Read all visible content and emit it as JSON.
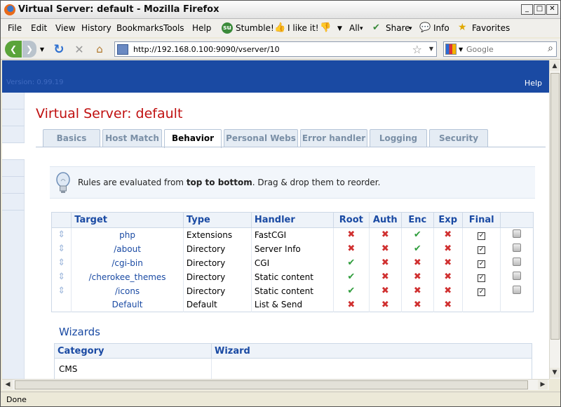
{
  "window": {
    "title": "Virtual Server: default - Mozilla Firefox"
  },
  "menu": [
    "File",
    "Edit",
    "View",
    "History",
    "Bookmarks",
    "Tools",
    "Help"
  ],
  "toolbar": {
    "stumble": "Stumble!",
    "like": "I like it!",
    "all": "All",
    "share": "Share",
    "info": "Info",
    "favorites": "Favorites"
  },
  "nav": {
    "url": "http://192.168.0.100:9090/vserver/10",
    "search_placeholder": "Google"
  },
  "app": {
    "version": "Version: 0.99.19",
    "help": "Help",
    "page_title": "Virtual Server: default",
    "tabs": [
      "Basics",
      "Host Match",
      "Behavior",
      "Personal Webs",
      "Error handler",
      "Logging",
      "Security"
    ],
    "active_tab": "Behavior",
    "notice_pre": "Rules are evaluated from ",
    "notice_bold": "top to bottom",
    "notice_post": ". Drag & drop them to reorder."
  },
  "rules": {
    "columns": [
      "Target",
      "Type",
      "Handler",
      "Root",
      "Auth",
      "Enc",
      "Exp",
      "Final"
    ],
    "rows": [
      {
        "target": "php",
        "type": "Extensions",
        "handler": "FastCGI",
        "root": "x",
        "auth": "x",
        "enc": "ok",
        "exp": "x",
        "final": true,
        "draggable": true
      },
      {
        "target": "/about",
        "type": "Directory",
        "handler": "Server Info",
        "root": "x",
        "auth": "x",
        "enc": "ok",
        "exp": "x",
        "final": true,
        "draggable": true
      },
      {
        "target": "/cgi-bin",
        "type": "Directory",
        "handler": "CGI",
        "root": "ok",
        "auth": "x",
        "enc": "x",
        "exp": "x",
        "final": true,
        "draggable": true
      },
      {
        "target": "/cherokee_themes",
        "type": "Directory",
        "handler": "Static content",
        "root": "ok",
        "auth": "x",
        "enc": "x",
        "exp": "x",
        "final": true,
        "draggable": true
      },
      {
        "target": "/icons",
        "type": "Directory",
        "handler": "Static content",
        "root": "ok",
        "auth": "x",
        "enc": "x",
        "exp": "x",
        "final": true,
        "draggable": true
      },
      {
        "target": "Default",
        "type": "Default",
        "handler": "List & Send",
        "root": "x",
        "auth": "x",
        "enc": "x",
        "exp": "x",
        "final": null,
        "draggable": false
      }
    ]
  },
  "wizards": {
    "heading": "Wizards",
    "columns": [
      "Category",
      "Wizard"
    ],
    "rows": [
      {
        "category": "CMS",
        "wizard": ""
      }
    ]
  },
  "status": {
    "text": "Done"
  }
}
